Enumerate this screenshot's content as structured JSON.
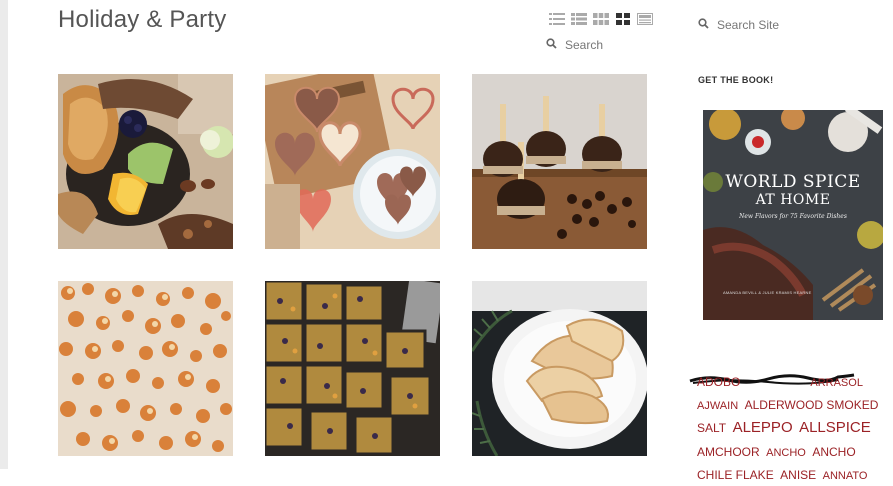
{
  "page": {
    "title": "Holiday & Party"
  },
  "view_modes": [
    {
      "name": "list-view-icon",
      "active": false
    },
    {
      "name": "compact-list-view-icon",
      "active": false
    },
    {
      "name": "small-grid-view-icon",
      "active": false
    },
    {
      "name": "large-grid-view-icon",
      "active": true
    },
    {
      "name": "card-view-icon",
      "active": false
    }
  ],
  "grid_search": {
    "label": "Search"
  },
  "site_search": {
    "label": "Search Site"
  },
  "recipes": [
    {
      "name": "recipe-cheese-board"
    },
    {
      "name": "recipe-heart-cookies"
    },
    {
      "name": "recipe-chocolate-pops"
    },
    {
      "name": "recipe-spiced-popcorn"
    },
    {
      "name": "recipe-fruit-bars"
    },
    {
      "name": "recipe-hand-pies"
    }
  ],
  "sidebar": {
    "book_heading": "GET THE BOOK!",
    "book": {
      "title_line1": "WORLD SPICE",
      "title_line2": "AT HOME",
      "subtitle": "New Flavors for 75 Favorite Dishes",
      "authors": "AMANDA BEVILL & JULIE KRAMIS HEARNE"
    },
    "tags_line1": [
      {
        "text": "ADOBO",
        "size": "t12"
      },
      {
        "text": "AJWAIN",
        "size": "t11"
      },
      {
        "text": "ALDERWOOD SMOKED SALT",
        "size": "t12"
      }
    ],
    "tag_arrasol": "ARRASOL",
    "tags": [
      {
        "text": "ALEPPO",
        "size": "t15"
      },
      {
        "text": "ALLSPICE",
        "size": "t15"
      },
      {
        "text": "AMCHOOR",
        "size": "t12"
      },
      {
        "text": "ANCHO",
        "size": "t11"
      },
      {
        "text": "ANCHO CHILE FLAKE",
        "size": "t12"
      },
      {
        "text": "ANISE",
        "size": "t12"
      },
      {
        "text": "ANNATO",
        "size": "t11"
      }
    ]
  },
  "colors": {
    "tag_red": "#9b2226",
    "title_gray": "#555555",
    "icon_gray": "#999999"
  }
}
